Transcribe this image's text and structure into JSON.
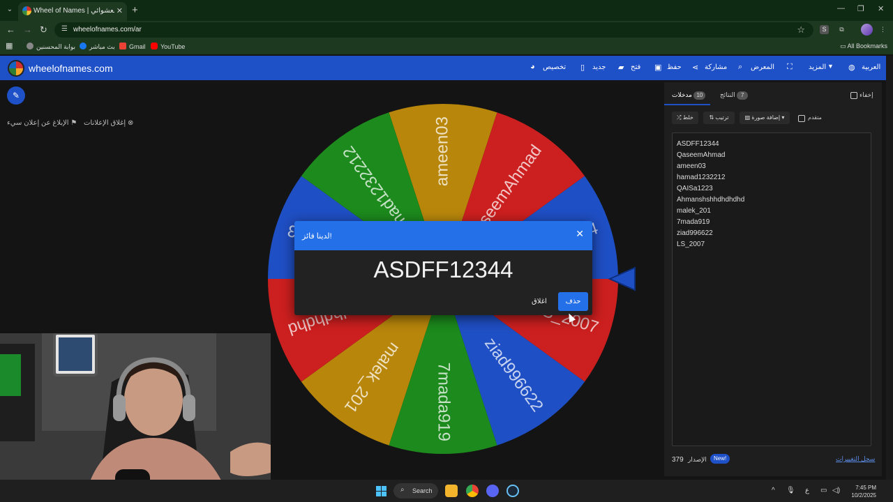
{
  "browser": {
    "tab_title": "Wheel of Names | عجلة الاسم العشوائي",
    "url": "wheelofnames.com/ar",
    "bookmarks": [
      "بوابة المحسنين",
      "بث مباشر",
      "Gmail",
      "YouTube"
    ],
    "all_bookmarks": "All Bookmarks"
  },
  "app": {
    "logo_text": "wheelofnames.com",
    "menu": {
      "customize": "تخصيص",
      "new": "جديد",
      "open": "فتح",
      "save": "حفظ",
      "share": "مشاركة",
      "gallery": "المعرض",
      "more": "المزيد",
      "language": "العربية"
    },
    "close_ads": "إغلاق الإعلانات",
    "report_ad": "الإبلاغ عن إعلان سيء"
  },
  "wheel": {
    "segments": [
      {
        "label": "ameen03",
        "color": "#b8860b"
      },
      {
        "label": "QaseemAhmad",
        "color": "#cc1f1f"
      },
      {
        "label": "ASDFF12344",
        "color": "#1f4fc4"
      },
      {
        "label": "LS_2007",
        "color": "#cc1f1f"
      },
      {
        "label": "ziad996622",
        "color": "#1f4fc4"
      },
      {
        "label": "7mada919",
        "color": "#1c8a1c"
      },
      {
        "label": "malek_201",
        "color": "#b8860b"
      },
      {
        "label": "Ahmanshshhdhdhdhd",
        "color": "#cc1f1f"
      },
      {
        "label": "QAISa1223",
        "color": "#1f4fc4"
      },
      {
        "label": "hamad1232212",
        "color": "#1c8a1c"
      }
    ]
  },
  "panel": {
    "hide_label": "إخفاء",
    "entries_tab": "مدخلات",
    "entries_count": "10",
    "results_tab": "النتائج",
    "results_count": "7",
    "shuffle": "خلط",
    "sort": "ترتيب",
    "add_image": "إضافة صورة",
    "advanced": "متقدم",
    "entries": [
      "ASDFF12344",
      "QaseemAhmad",
      "ameen03",
      "hamad1232212",
      "QAISa1223",
      "Ahmanshshhdhdhdhd",
      "malek_201",
      "7mada919",
      "ziad996622",
      "LS_2007"
    ],
    "version_number": "379",
    "version_label": "الإصدار",
    "new_badge": "New!",
    "changelog": "سجل التغييرات"
  },
  "dialog": {
    "title": "لدينا فائز!",
    "winner": "ASDFF12344",
    "close_button": "اغلاق",
    "remove_button": "حذف"
  },
  "taskbar": {
    "search": "Search",
    "language_indicator": "ع",
    "time": "7:45 PM",
    "date": "10/2/2025"
  }
}
